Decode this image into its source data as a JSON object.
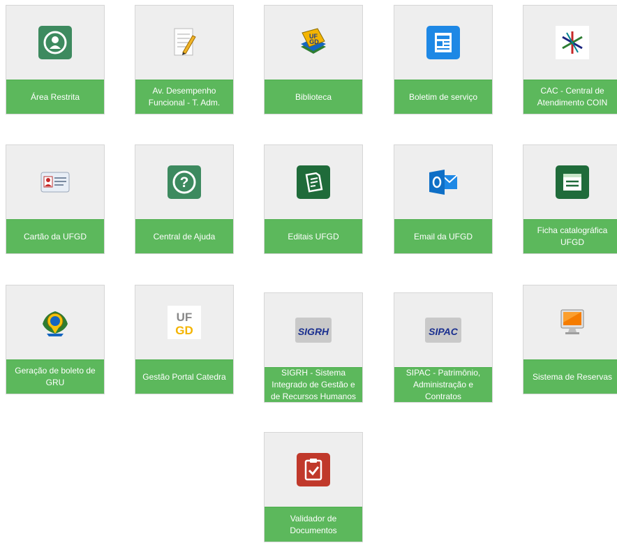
{
  "colors": {
    "tile_bg": "#eeeeee",
    "label_bg": "#5cb85c",
    "label_text": "#ffffff",
    "icon_green": "#3d8a5f",
    "icon_red": "#c0392b",
    "outlook_blue": "#0f6fc6"
  },
  "tiles": [
    {
      "label": "Área Restrita",
      "icon": "user-circle-icon"
    },
    {
      "label": "Av. Desempenho Funcional - T. Adm.",
      "icon": "notepad-pencil-icon"
    },
    {
      "label": "Biblioteca",
      "icon": "ufgd-books-icon"
    },
    {
      "label": "Boletim de serviço",
      "icon": "newspaper-icon"
    },
    {
      "label": "CAC - Central de Atendimento COIN",
      "icon": "cac-star-logo-icon"
    },
    {
      "label": "Cartão da UFGD",
      "icon": "id-card-icon"
    },
    {
      "label": "Central de Ajuda",
      "icon": "question-icon"
    },
    {
      "label": "Editais UFGD",
      "icon": "document-edit-icon"
    },
    {
      "label": "Email da UFGD",
      "icon": "outlook-icon"
    },
    {
      "label": "Ficha catalográfica UFGD",
      "icon": "catalog-card-icon"
    },
    {
      "label": "Geração de boleto de GRU",
      "icon": "brazil-coat-of-arms-icon"
    },
    {
      "label": "Gestão Portal Catedra",
      "icon": "ufgd-logo-icon"
    },
    {
      "label": "SIGRH - Sistema Integrado de Gestão e de Recursos Humanos",
      "icon": "sigrh-logo-icon",
      "logo_text": "SIGRH"
    },
    {
      "label": "SIPAC - Patrimônio, Administração e Contratos",
      "icon": "sipac-logo-icon",
      "logo_text": "SIPAC"
    },
    {
      "label": "Sistema de Reservas",
      "icon": "monitor-icon"
    },
    {
      "label": "Validador de Documentos",
      "icon": "clipboard-check-icon"
    }
  ]
}
